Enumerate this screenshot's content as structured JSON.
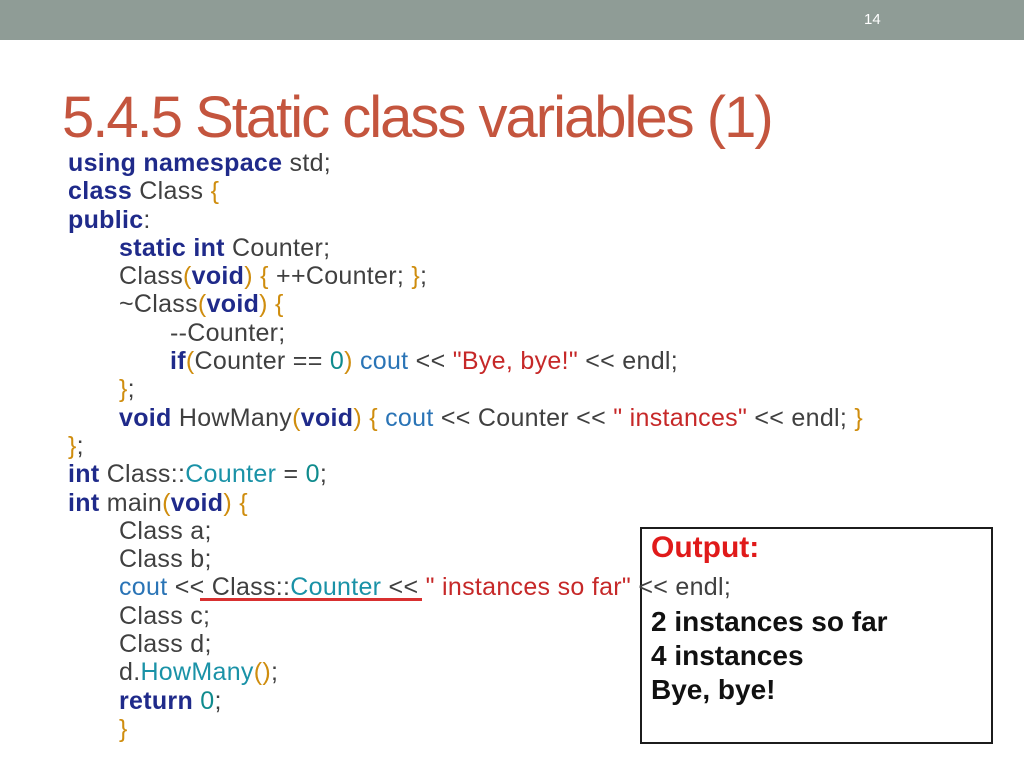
{
  "slide": {
    "number": "14",
    "title": "5.4.5 Static class variables (1)"
  },
  "colors": {
    "top_bar": "#8f9c96",
    "slide_number": "#ffffff",
    "title": "#c4553e",
    "keyword": "#1f2a8a",
    "identifier": "#404040",
    "bracket": "#cf8d0e",
    "string": "#c62828",
    "number": "#0f8b8d",
    "member": "#1a92a7",
    "stream": "#2a74b6",
    "underline": "#d83030",
    "output_label": "#e01a1a",
    "output_text": "#111111",
    "output_border": "#1c1c1c"
  },
  "code": {
    "lines": [
      {
        "indent": 0,
        "tokens": [
          {
            "t": "using namespace",
            "k": "keyword"
          },
          {
            "t": " std;",
            "k": "identifier"
          }
        ]
      },
      {
        "indent": 0,
        "tokens": [
          {
            "t": "class",
            "k": "keyword"
          },
          {
            "t": " Class ",
            "k": "identifier"
          },
          {
            "t": "{",
            "k": "bracket"
          }
        ]
      },
      {
        "indent": 0,
        "tokens": [
          {
            "t": "public",
            "k": "keyword"
          },
          {
            "t": ":",
            "k": "identifier"
          }
        ]
      },
      {
        "indent": 1,
        "tokens": [
          {
            "t": "static int",
            "k": "keyword"
          },
          {
            "t": " Counter;",
            "k": "identifier"
          }
        ]
      },
      {
        "indent": 1,
        "tokens": [
          {
            "t": "Class",
            "k": "identifier"
          },
          {
            "t": "(",
            "k": "bracket"
          },
          {
            "t": "void",
            "k": "keyword"
          },
          {
            "t": ")",
            "k": "bracket"
          },
          {
            "t": " ",
            "k": "identifier"
          },
          {
            "t": "{",
            "k": "bracket"
          },
          {
            "t": " ++Counter; ",
            "k": "identifier"
          },
          {
            "t": "}",
            "k": "bracket"
          },
          {
            "t": ";",
            "k": "identifier"
          }
        ]
      },
      {
        "indent": 1,
        "tokens": [
          {
            "t": "~Class",
            "k": "identifier"
          },
          {
            "t": "(",
            "k": "bracket"
          },
          {
            "t": "void",
            "k": "keyword"
          },
          {
            "t": ")",
            "k": "bracket"
          },
          {
            "t": " ",
            "k": "identifier"
          },
          {
            "t": "{",
            "k": "bracket"
          }
        ]
      },
      {
        "indent": 2,
        "tokens": [
          {
            "t": "--Counter;",
            "k": "identifier"
          }
        ]
      },
      {
        "indent": 2,
        "tokens": [
          {
            "t": "if",
            "k": "keyword"
          },
          {
            "t": "(",
            "k": "bracket"
          },
          {
            "t": "Counter == ",
            "k": "identifier"
          },
          {
            "t": "0",
            "k": "number"
          },
          {
            "t": ")",
            "k": "bracket"
          },
          {
            "t": " ",
            "k": "identifier"
          },
          {
            "t": "cout",
            "k": "stream"
          },
          {
            "t": " << ",
            "k": "identifier"
          },
          {
            "t": "\"Bye, bye!\"",
            "k": "string"
          },
          {
            "t": " << endl;",
            "k": "identifier"
          }
        ]
      },
      {
        "indent": 1,
        "tokens": [
          {
            "t": "}",
            "k": "bracket"
          },
          {
            "t": ";",
            "k": "identifier"
          }
        ]
      },
      {
        "indent": 1,
        "tokens": [
          {
            "t": "void",
            "k": "keyword"
          },
          {
            "t": " HowMany",
            "k": "identifier"
          },
          {
            "t": "(",
            "k": "bracket"
          },
          {
            "t": "void",
            "k": "keyword"
          },
          {
            "t": ")",
            "k": "bracket"
          },
          {
            "t": " ",
            "k": "identifier"
          },
          {
            "t": "{",
            "k": "bracket"
          },
          {
            "t": " ",
            "k": "identifier"
          },
          {
            "t": "cout",
            "k": "stream"
          },
          {
            "t": " << Counter << ",
            "k": "identifier"
          },
          {
            "t": "\" instances\"",
            "k": "string"
          },
          {
            "t": " << endl; ",
            "k": "identifier"
          },
          {
            "t": "}",
            "k": "bracket"
          }
        ]
      },
      {
        "indent": 0,
        "tokens": [
          {
            "t": "}",
            "k": "bracket"
          },
          {
            "t": ";",
            "k": "identifier"
          }
        ]
      },
      {
        "indent": 0,
        "tokens": [
          {
            "t": "int",
            "k": "keyword"
          },
          {
            "t": " Class::",
            "k": "identifier"
          },
          {
            "t": "Counter",
            "k": "member"
          },
          {
            "t": " = ",
            "k": "identifier"
          },
          {
            "t": "0",
            "k": "number"
          },
          {
            "t": ";",
            "k": "identifier"
          }
        ]
      },
      {
        "indent": 0,
        "tokens": [
          {
            "t": "int",
            "k": "keyword"
          },
          {
            "t": " main",
            "k": "identifier"
          },
          {
            "t": "(",
            "k": "bracket"
          },
          {
            "t": "void",
            "k": "keyword"
          },
          {
            "t": ")",
            "k": "bracket"
          },
          {
            "t": " ",
            "k": "identifier"
          },
          {
            "t": "{",
            "k": "bracket"
          }
        ]
      },
      {
        "indent": 1,
        "tokens": [
          {
            "t": "Class a;",
            "k": "identifier"
          }
        ]
      },
      {
        "indent": 1,
        "tokens": [
          {
            "t": "Class b;",
            "k": "identifier"
          }
        ]
      },
      {
        "indent": 1,
        "tokens": [
          {
            "t": "cout",
            "k": "stream"
          },
          {
            "t": " << Class::",
            "k": "identifier"
          },
          {
            "t": "Counter",
            "k": "member"
          },
          {
            "t": " << ",
            "k": "identifier"
          },
          {
            "t": "\" instances so far\"",
            "k": "string"
          },
          {
            "t": " << endl;",
            "k": "identifier"
          }
        ]
      },
      {
        "indent": 1,
        "tokens": [
          {
            "t": "Class c;",
            "k": "identifier"
          }
        ]
      },
      {
        "indent": 1,
        "tokens": [
          {
            "t": "Class d;",
            "k": "identifier"
          }
        ]
      },
      {
        "indent": 1,
        "tokens": [
          {
            "t": "d.",
            "k": "identifier"
          },
          {
            "t": "HowMany",
            "k": "member"
          },
          {
            "t": "()",
            "k": "bracket"
          },
          {
            "t": ";",
            "k": "identifier"
          }
        ]
      },
      {
        "indent": 1,
        "tokens": [
          {
            "t": "return",
            "k": "keyword"
          },
          {
            "t": " ",
            "k": "identifier"
          },
          {
            "t": "0",
            "k": "number"
          },
          {
            "t": ";",
            "k": "identifier"
          }
        ]
      },
      {
        "indent": 1,
        "tokens": [
          {
            "t": "}",
            "k": "bracket"
          }
        ]
      }
    ]
  },
  "output": {
    "label": "Output:",
    "lines": [
      "2 instances so far",
      "4 instances",
      "Bye, bye!"
    ]
  }
}
